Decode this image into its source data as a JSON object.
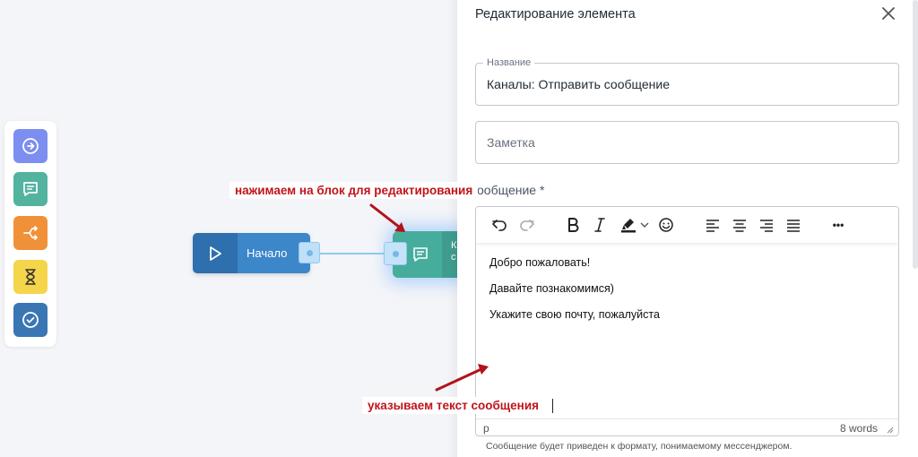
{
  "canvas": {
    "palette": [
      {
        "icon": "arrow-right-circle-icon",
        "color": "#7c8ef0"
      },
      {
        "icon": "message-icon",
        "color": "#52b39f"
      },
      {
        "icon": "branch-icon",
        "color": "#f0913a"
      },
      {
        "icon": "hourglass-icon",
        "color": "#f5d54a"
      },
      {
        "icon": "check-circle-icon",
        "color": "#3a76b4"
      }
    ],
    "start_node_label": "Начало",
    "message_node_label": "К\nс"
  },
  "annotations": {
    "block": "нажимаем на блок для редактирования",
    "text": "указываем текст сообщения"
  },
  "panel": {
    "title": "Редактирование элемента",
    "name_legend": "Название",
    "name_value": "Каналы: Отправить сообщение",
    "note_placeholder": "Заметка",
    "message_label": "ообщение *",
    "editor_lines": [
      "Добро пожаловать!",
      "Давайте познакомимся)",
      "Укажите свою почту, пожалуйста"
    ],
    "status_path": "p",
    "status_words": "8 words",
    "helper_text": "Сообщение будет приведен к формату, понимаемому мессенджером.",
    "more_label": "•••"
  },
  "colors": {
    "accent_red": "#c0141b",
    "start_node": "#3b87c9",
    "message_node": "#46ad9d"
  }
}
